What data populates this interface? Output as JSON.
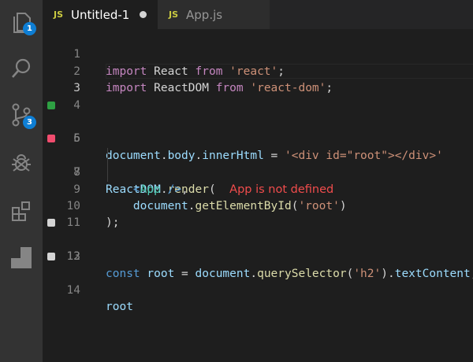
{
  "tabs": [
    {
      "badge": "JS",
      "label": "Untitled-1",
      "active": true,
      "dirty": true
    },
    {
      "badge": "JS",
      "label": "App.js",
      "active": false,
      "dirty": false
    }
  ],
  "activity_bar": {
    "items": [
      {
        "name": "explorer",
        "icon": "files-icon",
        "badge": "1"
      },
      {
        "name": "search",
        "icon": "search-icon"
      },
      {
        "name": "source-control",
        "icon": "source-control-icon",
        "badge": "3"
      },
      {
        "name": "debug",
        "icon": "bug-icon"
      },
      {
        "name": "extensions",
        "icon": "extensions-icon"
      },
      {
        "name": "quokka",
        "icon": "quokka-icon"
      }
    ]
  },
  "colors": {
    "marker_green": "#2ea043",
    "marker_red": "#f14c6e",
    "marker_gray": "#d4d4d4",
    "error_text": "#f14c4c"
  },
  "lines": {
    "n1": "1",
    "n2": "2",
    "n3": "3",
    "n4": "4",
    "n5": "5",
    "n6": "6",
    "n7": "7",
    "n8": "8",
    "n9": "9",
    "n10": "10",
    "n11": "11",
    "n12": "12",
    "n13": "13",
    "n14": "14",
    "l1": {
      "t1": "import",
      "t2": " React ",
      "t3": "from",
      "t4": " ",
      "t5": "'react'",
      "t6": ";"
    },
    "l2": {
      "t1": "import",
      "t2": " ReactDOM ",
      "t3": "from",
      "t4": " ",
      "t5": "'react-dom'",
      "t6": ";"
    },
    "l5": {
      "t1": "document",
      "t2": ".",
      "t3": "body",
      "t4": ".",
      "t5": "innerHtml",
      "t6": " = ",
      "t7": "'<div id=\"root\"></div>'"
    },
    "l7": {
      "t1": "ReactDOM",
      "t2": ".",
      "t3": "render",
      "t4": "(",
      "error": "App is not defined"
    },
    "l8": {
      "t1": "<",
      "t2": "App",
      "t3": " />",
      "t4": ","
    },
    "l9": {
      "t1": "document",
      "t2": ".",
      "t3": "getElementById",
      "t4": "(",
      "t5": "'root'",
      "t6": ")"
    },
    "l10": {
      "t1": ");"
    },
    "l12": {
      "t1": "const",
      "t2": " ",
      "t3": "root",
      "t4": " = ",
      "t5": "document",
      "t6": ".",
      "t7": "querySelector",
      "t8": "(",
      "t9": "'h2'",
      "t10": ").",
      "t11": "textContent",
      "t12": ";"
    },
    "l14": {
      "t1": "root"
    }
  }
}
